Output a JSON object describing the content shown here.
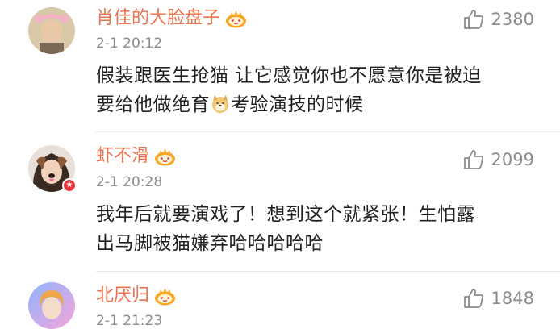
{
  "comments": [
    {
      "username": "肖佳的大脸盘子",
      "time": "2-1 20:12",
      "text_line1": "假装跟医生抢猫 让它感觉你也不愿意你是被迫",
      "text_line2_a": "要给他做绝育",
      "text_line2_b": "考验演技的时候",
      "likes": "2380",
      "verified": false
    },
    {
      "username": "虾不滑",
      "time": "2-1 20:28",
      "text_line1": "我年后就要演戏了！想到这个就紧张！生怕露",
      "text_line2": "出马脚被猫嫌弃哈哈哈哈哈",
      "likes": "2099",
      "verified": true
    },
    {
      "username": "北厌归",
      "time": "2-1 21:23",
      "likes": "1848",
      "verified": false
    }
  ],
  "colors": {
    "username": "#eb7350",
    "meta": "#8c8c8c",
    "text": "#222222",
    "crown": "#f5a623",
    "verified_badge": "#e8373b"
  },
  "icons": {
    "like": "thumbs-up-icon",
    "member": "crown-badge-icon",
    "emoji": "doge-emoji-icon"
  }
}
